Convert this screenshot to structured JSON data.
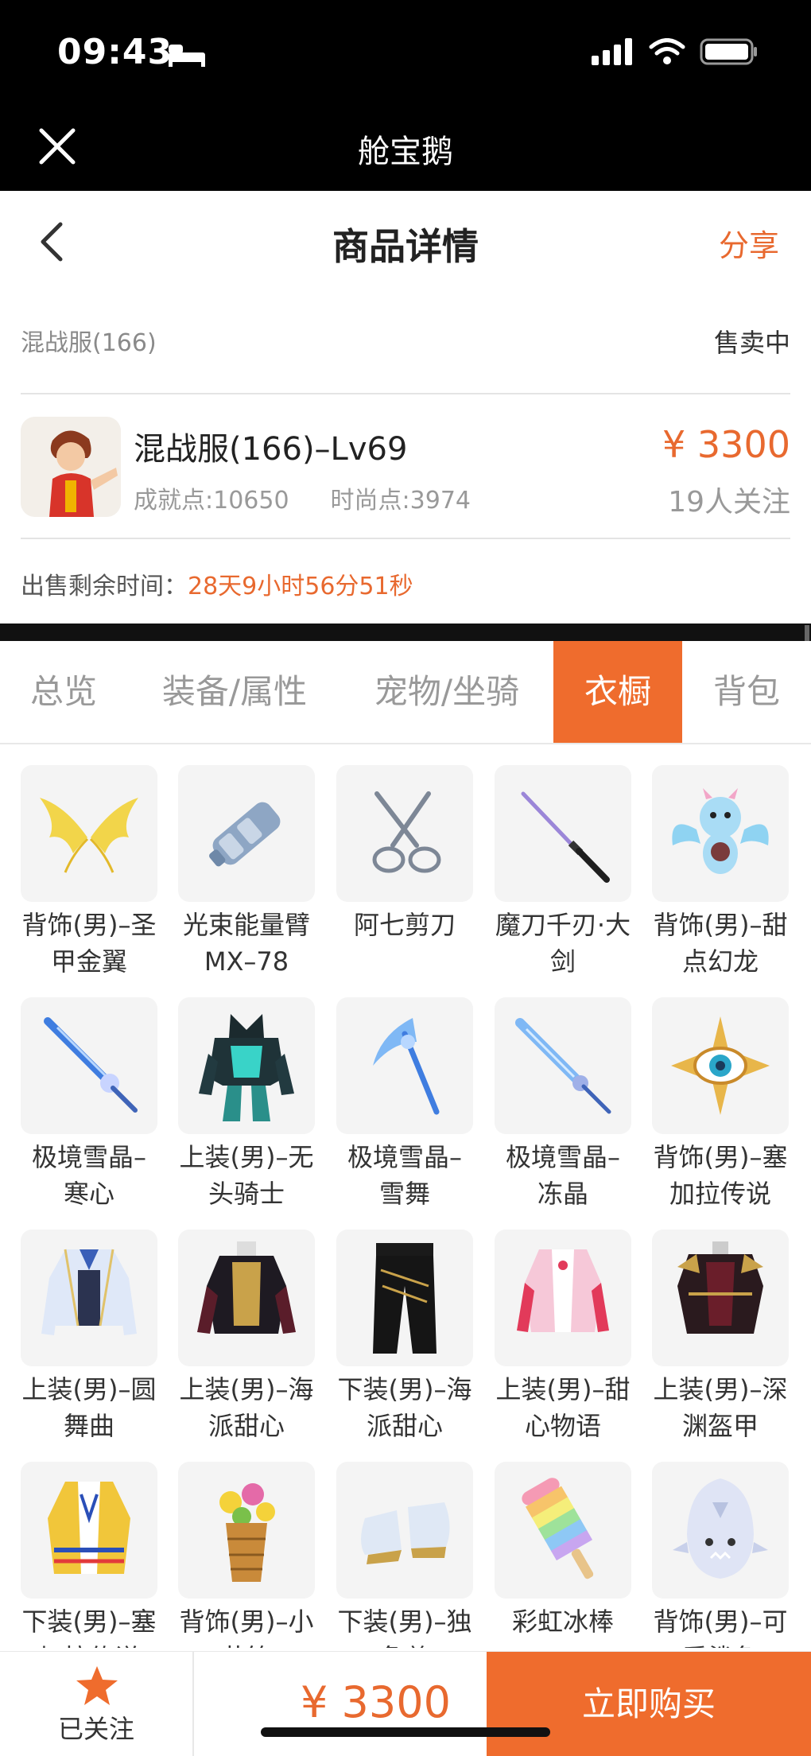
{
  "status_bar": {
    "time": "09:43"
  },
  "appbar": {
    "title": "舱宝鹅"
  },
  "navbar": {
    "title": "商品详情",
    "share": "分享"
  },
  "server": {
    "name": "混战服(166)",
    "status": "售卖中"
  },
  "product": {
    "title": "混战服(166)–Lv69",
    "achievement": "成就点:10650",
    "fashion": "时尚点:3974",
    "price": "¥ 3300",
    "followers": "19人关注"
  },
  "remain": {
    "label": "出售剩余时间：",
    "value": "28天9小时56分51秒"
  },
  "tabs": [
    {
      "label": "总览"
    },
    {
      "label": "装备/属性"
    },
    {
      "label": "宠物/坐骑"
    },
    {
      "label": "衣橱"
    },
    {
      "label": "背包"
    }
  ],
  "items": [
    {
      "name": "背饰(男)–圣甲金翼",
      "icon": "golden-wings-icon"
    },
    {
      "name": "光束能量臂MX–78",
      "icon": "energy-arm-icon"
    },
    {
      "name": "阿七剪刀",
      "icon": "scissors-icon"
    },
    {
      "name": "魔刀千刃·大剑",
      "icon": "katana-icon"
    },
    {
      "name": "背饰(男)–甜点幻龙",
      "icon": "dragon-icon"
    },
    {
      "name": "极境雪晶–寒心",
      "icon": "ice-sword-icon"
    },
    {
      "name": "上装(男)–无头骑士",
      "icon": "knight-armor-icon"
    },
    {
      "name": "极境雪晶–雪舞",
      "icon": "ice-scythe-icon"
    },
    {
      "name": "极境雪晶–冻晶",
      "icon": "ice-spear-icon"
    },
    {
      "name": "背饰(男)–塞加拉传说",
      "icon": "eye-emblem-icon"
    },
    {
      "name": "上装(男)–圆舞曲",
      "icon": "waltz-jacket-icon"
    },
    {
      "name": "上装(男)–海派甜心",
      "icon": "navy-jacket-icon"
    },
    {
      "name": "下装(男)–海派甜心",
      "icon": "black-pants-icon"
    },
    {
      "name": "上装(男)–甜心物语",
      "icon": "pink-outfit-icon"
    },
    {
      "name": "上装(男)–深渊盔甲",
      "icon": "abyss-armor-icon"
    },
    {
      "name": "下装(男)–塞加拉传说",
      "icon": "tribal-coat-icon"
    },
    {
      "name": "背饰(男)–小花筐",
      "icon": "flower-basket-icon"
    },
    {
      "name": "下装(男)–独角兽",
      "icon": "unicorn-boots-icon"
    },
    {
      "name": "彩虹冰棒",
      "icon": "rainbow-popsicle-icon"
    },
    {
      "name": "背饰(男)–可爱鲨鱼",
      "icon": "shark-backpack-icon"
    }
  ],
  "bottom": {
    "follow_label": "已关注",
    "price": "¥ 3300",
    "buy_label": "立即购买"
  },
  "colors": {
    "accent": "#ef6c2d",
    "price": "#e8692f"
  }
}
